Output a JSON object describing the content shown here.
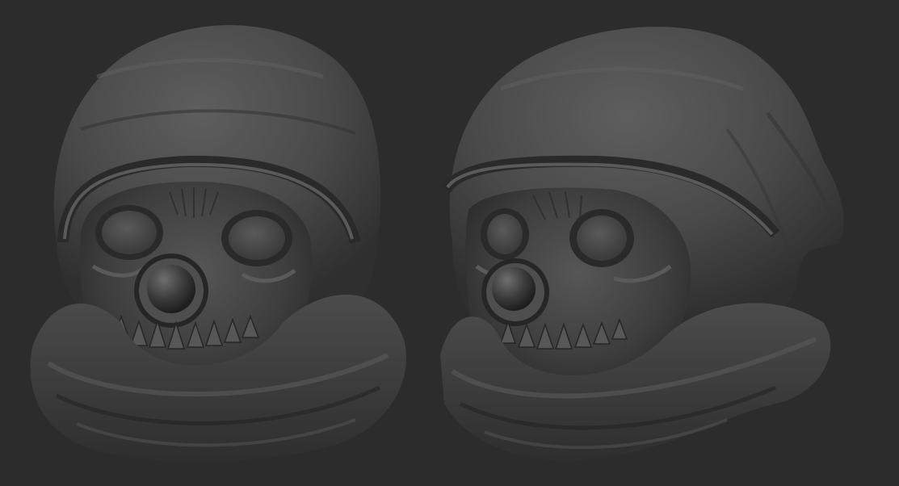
{
  "scene": {
    "background_color": "#2c2c2c",
    "clay_color": "#4a4a4a",
    "views": [
      {
        "name": "front-view",
        "angle": "front"
      },
      {
        "name": "three-quarter-view",
        "angle": "three-quarter"
      }
    ]
  }
}
